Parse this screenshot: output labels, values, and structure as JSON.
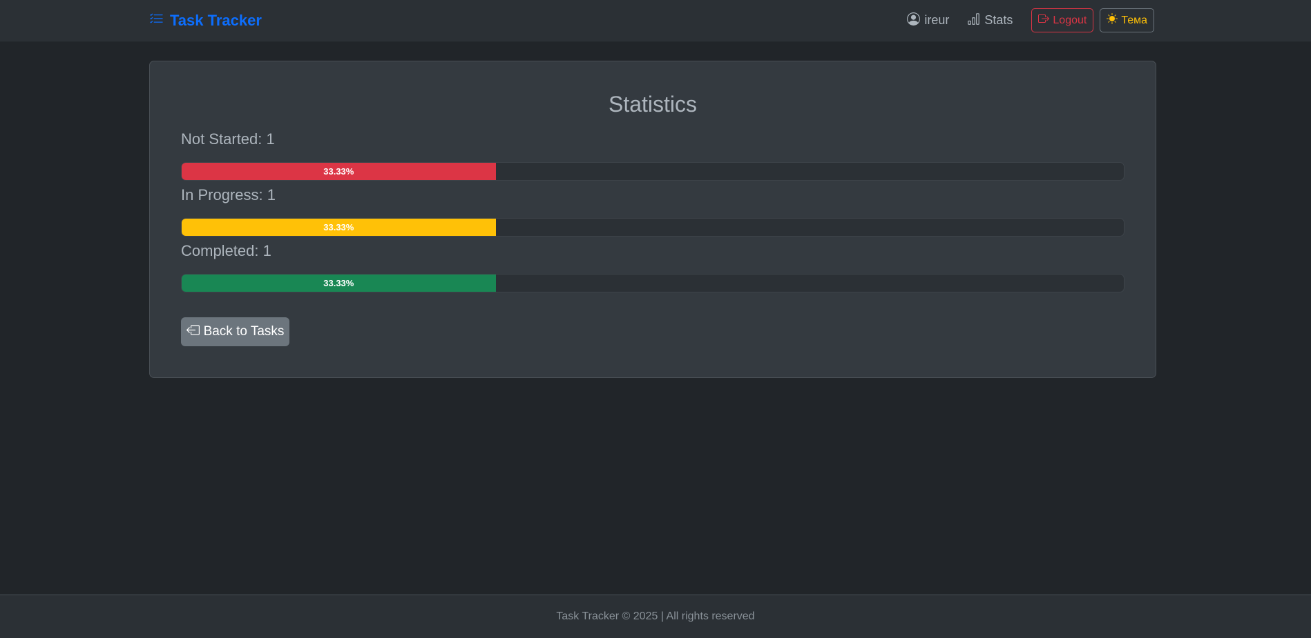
{
  "navbar": {
    "brand": "Task Tracker",
    "user": "ireur",
    "stats": "Stats",
    "logout": "Logout",
    "theme": "Тема"
  },
  "main": {
    "title": "Statistics",
    "stats": [
      {
        "label": "Not Started: 1",
        "percent_text": "33.33%",
        "percent": 33.33,
        "color": "#dc3545"
      },
      {
        "label": "In Progress: 1",
        "percent_text": "33.33%",
        "percent": 33.33,
        "color": "#ffc107"
      },
      {
        "label": "Completed: 1",
        "percent_text": "33.33%",
        "percent": 33.33,
        "color": "#198754"
      }
    ],
    "back_button": "Back to Tasks"
  },
  "footer": {
    "text": "Task Tracker © 2025 | All rights reserved"
  },
  "colors": {
    "accent": "#0d6efd",
    "danger": "#dc3545",
    "warning": "#ffc107",
    "success": "#198754",
    "secondary": "#6c757d"
  }
}
